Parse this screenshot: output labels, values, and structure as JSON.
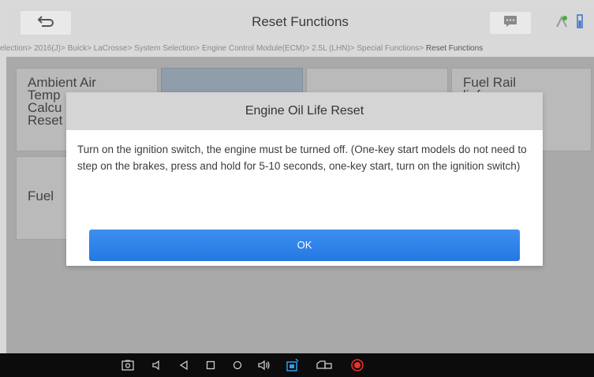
{
  "header": {
    "title": "Reset Functions"
  },
  "breadcrumb": {
    "path": "election> 2016(J)> Buick> LaCrosse> System Selection> Engine Control Module(ECM)> 2.5L (LHN)> Special Functions> ",
    "current": "Reset Functions"
  },
  "tiles": [
    {
      "label": "Ambient Air\nTemp\nCalcu\nReset"
    },
    {
      "label": ""
    },
    {
      "label": ""
    },
    {
      "label": "Fuel Rail\nlief\ned\nt"
    },
    {
      "label": "Fuel"
    }
  ],
  "dialog": {
    "title": "Engine Oil Life Reset",
    "message": "Turn on the ignition switch, the engine must be turned off. (One-key start models do not need to step on the brakes, press and hold for 5-10 seconds, one-key start, turn on the ignition switch)",
    "ok_label": "OK"
  },
  "navbar": {
    "icons": [
      "screenshot-icon",
      "volume-down-icon",
      "back-icon",
      "home-icon",
      "circle-icon",
      "volume-up-icon",
      "vci-icon",
      "vehicle-icon",
      "record-icon"
    ]
  },
  "colors": {
    "accent": "#2d84ea",
    "record": "#e8322f"
  }
}
